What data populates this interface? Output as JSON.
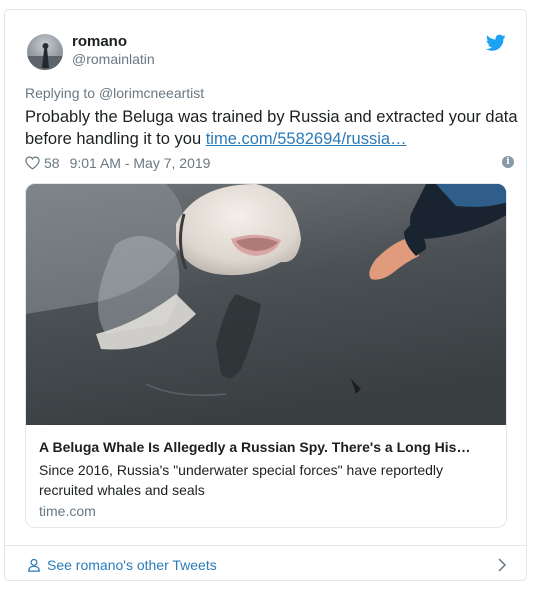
{
  "tweet": {
    "name": "romano",
    "handle": "@romainlatin",
    "reply_prefix": "Replying to ",
    "reply_to": "@lorimcneeartist",
    "text": "Probably the Beluga was trained by Russia and extracted your data before handling it to you ",
    "link_text": "time.com/5582694/russia…",
    "likes": "58",
    "timestamp": "9:01 AM - May 7, 2019",
    "info_glyph": "i"
  },
  "link_card": {
    "title": "A Beluga Whale Is Allegedly a Russian Spy. There's a Long His…",
    "description": "Since 2016, Russia's \"underwater special forces\" have reportedly recruited whales and seals",
    "domain": "time.com"
  },
  "footer": {
    "label": "See romano's other Tweets"
  },
  "icons": [
    "avatar",
    "twitter-bird-icon",
    "heart-icon",
    "info-icon",
    "person-icon",
    "chevron-right-icon"
  ],
  "colors": {
    "link": "#2b7bb9",
    "twitter_blue": "#1da1f2",
    "muted": "#697882",
    "border": "#e1e8ed"
  }
}
